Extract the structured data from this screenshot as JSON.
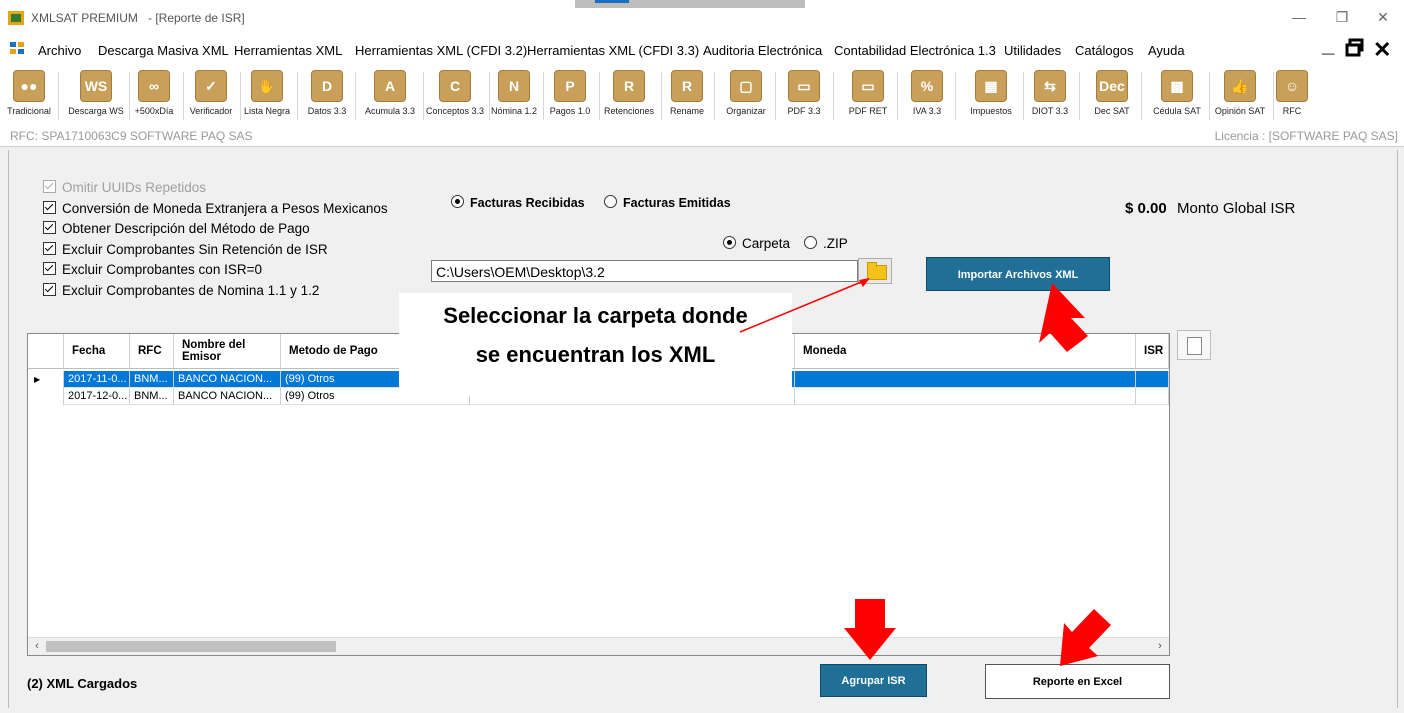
{
  "window": {
    "app_title": "XMLSAT PREMIUM",
    "document_title": "- [Reporte de ISR]",
    "controls": {
      "minimize": "—",
      "restore": "❐",
      "close": "✕"
    },
    "accent_color": "#1f6f97"
  },
  "menu": {
    "items": [
      "Archivo",
      "Descarga Masiva XML",
      "Herramientas XML",
      "Herramientas XML (CFDI 3.2)",
      "Herramientas XML (CFDI 3.3)",
      "Auditoria Electrónica",
      "Contabilidad Electrónica 1.3",
      "Utilidades",
      "Catálogos",
      "Ayuda"
    ],
    "mdi": {
      "minimize": "_",
      "restore": "🗗",
      "close": "✕"
    }
  },
  "toolbar": {
    "tools": [
      {
        "label": "Tradicional",
        "glyph": "●●",
        "icon": "grid-icon"
      },
      {
        "label": "Descarga WS",
        "glyph": "WS",
        "icon": "ws-icon"
      },
      {
        "label": "+500xDía",
        "glyph": "∞",
        "icon": "toggle-icon"
      },
      {
        "label": "Verificador",
        "glyph": "✓",
        "icon": "check-icon"
      },
      {
        "label": "Lista Negra",
        "glyph": "✋",
        "icon": "hand-icon"
      },
      {
        "label": "Datos 3.3",
        "glyph": "D",
        "icon": "xml-d-icon"
      },
      {
        "label": "Acumula 3.3",
        "glyph": "A",
        "icon": "xml-a-icon"
      },
      {
        "label": "Conceptos 3.3",
        "glyph": "C",
        "icon": "xml-c-icon"
      },
      {
        "label": "Nómina 1.2",
        "glyph": "N",
        "icon": "xml-n-icon"
      },
      {
        "label": "Pagos 1.0",
        "glyph": "P",
        "icon": "xml-p-icon"
      },
      {
        "label": "Retenciones",
        "glyph": "R",
        "icon": "xml-r-icon"
      },
      {
        "label": "Rename",
        "glyph": "R",
        "icon": "rename-icon"
      },
      {
        "label": "Organizar",
        "glyph": "▢",
        "icon": "organize-icon"
      },
      {
        "label": "PDF 3.3",
        "glyph": "▭",
        "icon": "pdf-icon"
      },
      {
        "label": "PDF RET",
        "glyph": "▭",
        "icon": "pdf-ret-icon"
      },
      {
        "label": "IVA 3.3",
        "glyph": "%",
        "icon": "percent-icon"
      },
      {
        "label": "Impuestos",
        "glyph": "▦",
        "icon": "calculator-icon"
      },
      {
        "label": "DIOT 3.3",
        "glyph": "⇆",
        "icon": "handshake-icon"
      },
      {
        "label": "Dec SAT",
        "glyph": "Dec",
        "icon": "dec-icon"
      },
      {
        "label": "Cédula SAT",
        "glyph": "▩",
        "icon": "qr-icon"
      },
      {
        "label": "Opinión SAT",
        "glyph": "👍",
        "icon": "thumbs-up-icon"
      },
      {
        "label": "RFC",
        "glyph": "☺",
        "icon": "person-icon"
      }
    ]
  },
  "rfc_bar": {
    "left": "RFC: SPA1710063C9 SOFTWARE PAQ SAS",
    "right": "Licencia : [SOFTWARE PAQ SAS]"
  },
  "options": {
    "omit_uuids": "Omitir UUIDs Repetidos",
    "currency": "Conversión de Moneda Extranjera a Pesos Mexicanos",
    "payment_method": "Obtener Descripción del Método de Pago",
    "exclude_no_ret": "Excluir Comprobantes Sin Retención de ISR",
    "exclude_isr0": "Excluir Comprobantes con ISR=0",
    "exclude_nomina": "Excluir Comprobantes de Nomina 1.1 y 1.2"
  },
  "invoice_type": {
    "received": "Facturas Recibidas",
    "issued": "Facturas Emitidas",
    "selected": "received"
  },
  "source_type": {
    "folder": "Carpeta",
    "zip": ".ZIP",
    "selected": "folder"
  },
  "monto": {
    "value": "$ 0.00",
    "label": "Monto Global ISR"
  },
  "path": {
    "value": "C:\\Users\\OEM\\Desktop\\3.2"
  },
  "buttons": {
    "import": "Importar Archivos  XML",
    "group": "Agrupar ISR",
    "excel": "Reporte en Excel"
  },
  "grid": {
    "columns": [
      "Fecha",
      "RFC",
      "Nombre del Emisor",
      "Metodo de Pago",
      "",
      "Moneda",
      "ISR"
    ],
    "rows": [
      {
        "fecha": "2017-11-0...",
        "rfc": "BNM...",
        "emisor": "BANCO NACION...",
        "metodo": "(99) Otros",
        "selected": true
      },
      {
        "fecha": "2017-12-0...",
        "rfc": "BNM...",
        "emisor": "BANCO NACION...",
        "metodo": "(99) Otros",
        "selected": false
      }
    ]
  },
  "annotation": {
    "line1": "Seleccionar la carpeta donde",
    "line2": "se encuentran los XML",
    "arrow_color": "#ff0000"
  },
  "status": {
    "loaded": "(2) XML Cargados"
  }
}
